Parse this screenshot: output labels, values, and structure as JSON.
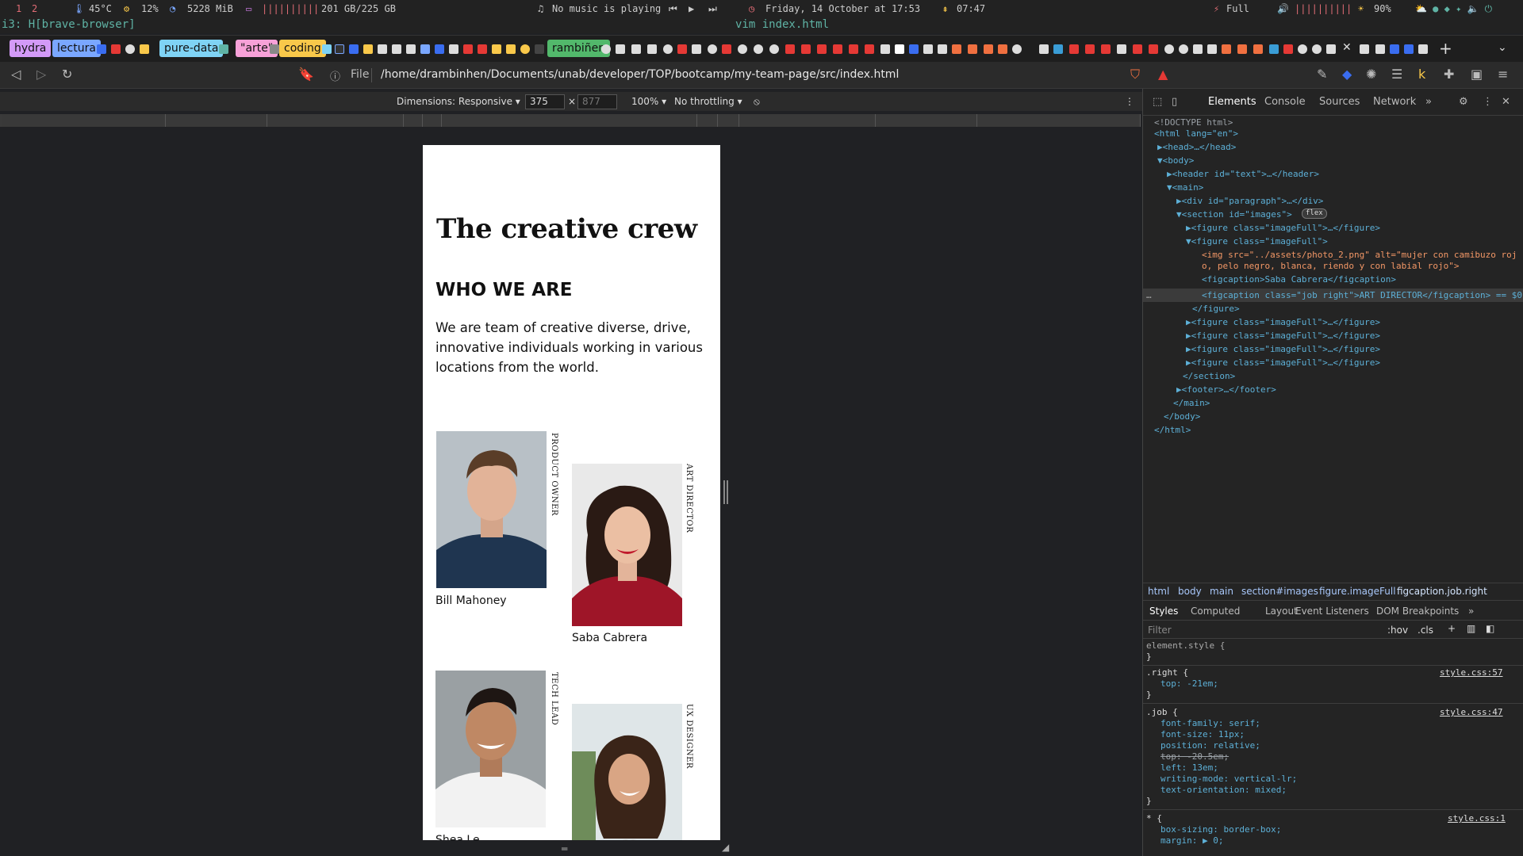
{
  "statusbar": {
    "workspaces": [
      "1",
      "2"
    ],
    "temp": "45°C",
    "cpu": "12%",
    "mem": "5228 MiB",
    "disk": "201 GB/225 GB",
    "music": "No music is playing",
    "datetime": "Friday, 14 October at 17:53",
    "uptime": "07:47",
    "battery": "Full",
    "brightness": "90%"
  },
  "window": {
    "i3_title": "i3: H[brave-browser]",
    "center_title": "vim index.html"
  },
  "tabs": {
    "tags": [
      "hydra",
      "lectura",
      "pure-data",
      "\"arte\"",
      "coding",
      "rambiñen"
    ],
    "colors": {
      "hydra": "#d39af7",
      "lectura": "#7aa7ff",
      "pure-data": "#7fd3f5",
      "arte": "#f7a1d8",
      "coding": "#f9c84a",
      "rambinen": "#52b86b"
    }
  },
  "urlbar": {
    "file_label": "File",
    "path": "/home/drambinhen/Documents/unab/developer/TOP/bootcamp/my-team-page/src/index.html"
  },
  "device": {
    "dimensions": "Dimensions: Responsive ▾",
    "width": "375",
    "times": "×",
    "height": "877",
    "zoom": "100% ▾",
    "throttling": "No throttling ▾"
  },
  "page": {
    "title": "The creative crew",
    "subtitle": "WHO WE ARE",
    "paragraph": "We are team of creative diverse, drive, innovative individuals working in various locations from the world.",
    "members": [
      {
        "name": "Bill Mahoney",
        "job": "PRODUCT OWNER"
      },
      {
        "name": "Saba Cabrera",
        "job": "ART DIRECTOR"
      },
      {
        "name": "Shea Le",
        "job": "TECH LEAD"
      },
      {
        "name": "",
        "job": "UX DESIGNER"
      }
    ]
  },
  "devtools": {
    "tabs": [
      "Elements",
      "Console",
      "Sources",
      "Network",
      "»"
    ],
    "tree": [
      "<!DOCTYPE html>",
      "<html lang=\"en\">",
      "▶<head>…</head>",
      "▼<body>",
      "▶<header id=\"text\">…</header>",
      "▼<main>",
      "▶<div id=\"paragraph\">…</div>",
      "▼<section id=\"images\">",
      "▶<figure class=\"imageFull\">…</figure>",
      "▼<figure class=\"imageFull\">",
      "<img src=\"../assets/photo_2.png\" alt=\"mujer con camibuzo roj",
      "o, pelo negro, blanca, riendo y con labial rojo\">",
      "<figcaption>Saba Cabrera</figcaption>",
      "<figcaption class=\"job right\">ART DIRECTOR</figcaption> == $0",
      "</figure>",
      "▶<figure class=\"imageFull\">…</figure>",
      "▶<figure class=\"imageFull\">…</figure>",
      "▶<figure class=\"imageFull\">…</figure>",
      "▶<figure class=\"imageFull\">…</figure>",
      "</section>",
      "▶<footer>…</footer>",
      "</main>",
      "</body>",
      "</html>"
    ],
    "flex_badge": "flex",
    "crumbs": [
      "html",
      "body",
      "main",
      "section#images",
      "figure.imageFull",
      "figcaption.job.right"
    ],
    "subtabs": [
      "Styles",
      "Computed",
      "Layout",
      "Event Listeners",
      "DOM Breakpoints",
      "»"
    ],
    "filter": "Filter",
    "hov": ":hov",
    "cls": ".cls",
    "styles": {
      "element_style": "element.style {",
      "right_sel": ".right {",
      "right_src": "style.css:57",
      "right_top": "top: -21em;",
      "job_sel": ".job {",
      "job_src": "style.css:47",
      "job_props": [
        "font-family: serif;",
        "font-size: 11px;",
        "position: relative;",
        "top: -20.5em;",
        "left: 13em;",
        "writing-mode: vertical-lr;",
        "text-orientation: mixed;"
      ],
      "star_sel": "* {",
      "star_src": "style.css:1",
      "star_props": [
        "box-sizing: border-box;",
        "margin: ▶ 0;"
      ],
      "close": "}"
    }
  }
}
